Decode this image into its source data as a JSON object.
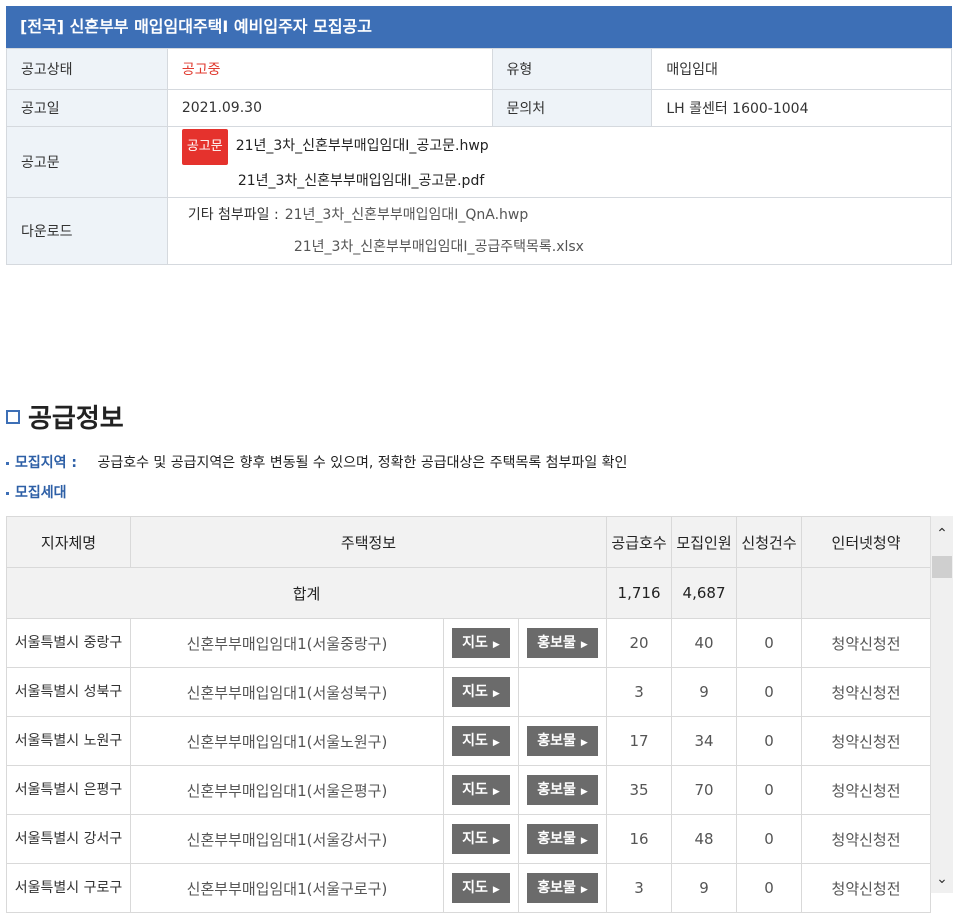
{
  "header": {
    "title": "[전국] 신혼부부 매입임대주택Ⅰ 예비입주자 모집공고"
  },
  "info": {
    "status_label": "공고상태",
    "status_value": "공고중",
    "type_label": "유형",
    "type_value": "매입임대",
    "date_label": "공고일",
    "date_value": "2021.09.30",
    "contact_label": "문의처",
    "contact_value": "LH 콜센터 1600-1004",
    "notice_label": "공고문",
    "notice_tag": "공고문",
    "notice_file1": "21년_3차_신혼부부매입임대Ⅰ_공고문.hwp",
    "notice_file2": "21년_3차_신혼부부매입임대Ⅰ_공고문.pdf",
    "download_label": "다운로드",
    "other_label": "기타 첨부파일 :",
    "attach1": "21년_3차_신혼부부매입임대Ⅰ_QnA.hwp",
    "attach2": "21년_3차_신혼부부매입임대Ⅰ_공급주택목록.xlsx"
  },
  "section": {
    "title": "공급정보",
    "region_label": "모집지역 :",
    "region_text": "공급호수 및 공급지역은 향후 변동될 수 있으며, 정확한 공급대상은 주택목록 첨부파일 확인",
    "household_label": "모집세대"
  },
  "table": {
    "headers": {
      "branch": "지자체명",
      "house": "주택정보",
      "supply": "공급호수",
      "recruit": "모집인원",
      "apply": "신청건수",
      "online": "인터넷청약"
    },
    "sum": {
      "label": "합계",
      "supply": "1,716",
      "recruit": "4,687"
    },
    "map_btn": "지도",
    "promo_btn": "홍보물",
    "rows": [
      {
        "branch": "서울특별시 중랑구",
        "house": "신혼부부매입임대1(서울중랑구)",
        "supply": "20",
        "recruit": "40",
        "apply": "0",
        "online": "청약신청전"
      },
      {
        "branch": "서울특별시 성북구",
        "house": "신혼부부매입임대1(서울성북구)",
        "supply": "3",
        "recruit": "9",
        "apply": "0",
        "online": "청약신청전"
      },
      {
        "branch": "서울특별시 노원구",
        "house": "신혼부부매입임대1(서울노원구)",
        "supply": "17",
        "recruit": "34",
        "apply": "0",
        "online": "청약신청전"
      },
      {
        "branch": "서울특별시 은평구",
        "house": "신혼부부매입임대1(서울은평구)",
        "supply": "35",
        "recruit": "70",
        "apply": "0",
        "online": "청약신청전"
      },
      {
        "branch": "서울특별시 강서구",
        "house": "신혼부부매입임대1(서울강서구)",
        "supply": "16",
        "recruit": "48",
        "apply": "0",
        "online": "청약신청전"
      },
      {
        "branch": "서울특별시 구로구",
        "house": "신혼부부매입임대1(서울구로구)",
        "supply": "3",
        "recruit": "9",
        "apply": "0",
        "online": "청약신청전"
      }
    ]
  }
}
